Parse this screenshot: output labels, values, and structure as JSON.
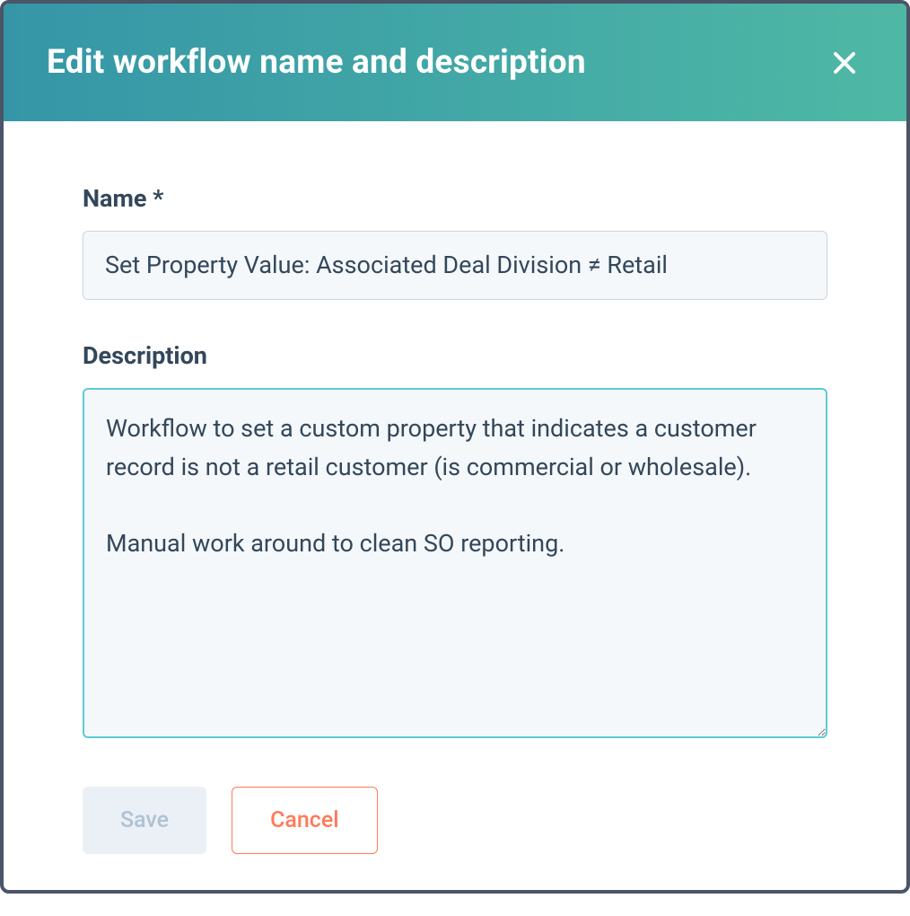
{
  "modal": {
    "title": "Edit workflow name and description"
  },
  "form": {
    "name": {
      "label": "Name *",
      "value": "Set Property Value: Associated Deal Division ≠ Retail"
    },
    "description": {
      "label": "Description",
      "value": "Workflow to set a custom property that indicates a customer record is not a retail customer (is commercial or wholesale).\n\nManual work around to clean SO reporting."
    }
  },
  "buttons": {
    "save": "Save",
    "cancel": "Cancel"
  }
}
